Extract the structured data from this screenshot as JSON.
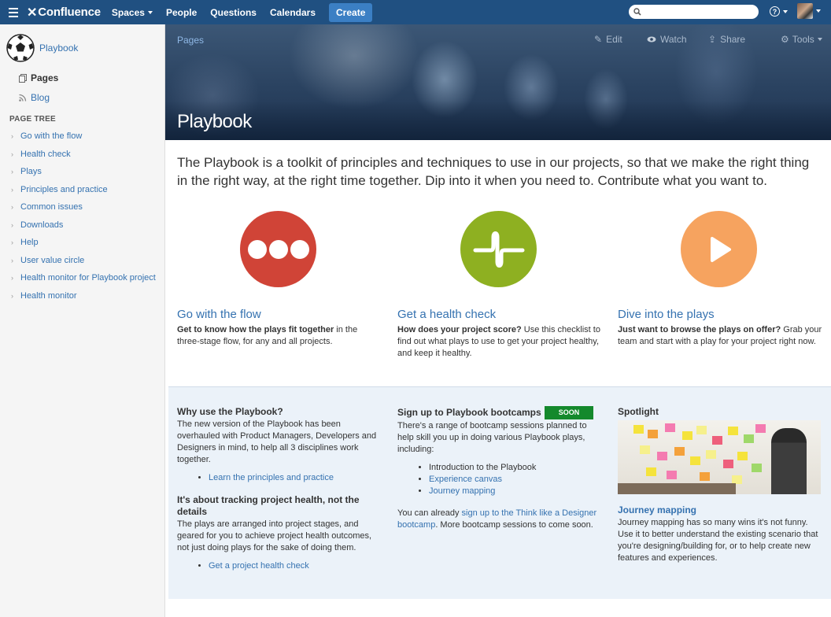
{
  "topnav": {
    "logo": "Confluence",
    "spaces": "Spaces",
    "people": "People",
    "questions": "Questions",
    "calendars": "Calendars",
    "create": "Create",
    "search_placeholder": ""
  },
  "sidebar": {
    "space_name": "Playbook",
    "pages": "Pages",
    "blog": "Blog",
    "tree_heading": "PAGE TREE",
    "tree": [
      "Go with the flow",
      "Health check",
      "Plays",
      "Principles and practice",
      "Common issues",
      "Downloads",
      "Help",
      "User value circle",
      "Health monitor for Playbook project",
      "Health monitor"
    ]
  },
  "hero": {
    "breadcrumb": "Pages",
    "edit": "Edit",
    "watch": "Watch",
    "share": "Share",
    "tools": "Tools",
    "title": "Playbook"
  },
  "intro": "The Playbook is a toolkit of principles and techniques to use in our projects, so that we make the right thing in the right way, at the right time together. Dip into it when you need to. Contribute what you want to.",
  "features": [
    {
      "title": "Go with the flow",
      "lead": "Get to know how the plays fit together",
      "rest": " in the three-stage flow, for any and all projects.",
      "color": "#d04437"
    },
    {
      "title": "Get a health check",
      "lead": "How does your project score?",
      "rest": " Use this checklist to find out what plays to use to get your project healthy, and keep it healthy.",
      "color": "#8eb021"
    },
    {
      "title": "Dive into the plays",
      "lead": "Just want to browse the plays on offer?",
      "rest": " Grab your team and start with a play for your project right now.",
      "color": "#f6a35f"
    }
  ],
  "why": {
    "heading": "Why use the Playbook?",
    "body": "The new version of the Playbook has been overhauled with Product Managers, Developers and Designers in mind, to help all 3 disciplines work together.",
    "link1": "Learn the principles and practice",
    "heading2": "It's about tracking project health, not the details",
    "body2": "The plays are arranged into project stages, and geared for you to achieve project health outcomes, not just doing plays for the sake of doing them.",
    "link2": "Get a project health check"
  },
  "bootcamp": {
    "heading": "Sign up to Playbook bootcamps",
    "badge": "SOON",
    "body": "There's a range of bootcamp sessions planned to help skill you up in doing various Playbook plays, including:",
    "items": [
      "Introduction to the Playbook",
      "Experience canvas",
      "Journey mapping"
    ],
    "tail_pre": "You can already ",
    "tail_link": "sign up to the Think like a Designer bootcamp",
    "tail_post": ". More bootcamp sessions to come soon."
  },
  "spotlight": {
    "heading": "Spotlight",
    "link": "Journey mapping",
    "body": "Journey mapping has so many wins it's not funny. Use it to better understand the existing scenario that you're designing/building for, or to help create new features and experiences."
  }
}
